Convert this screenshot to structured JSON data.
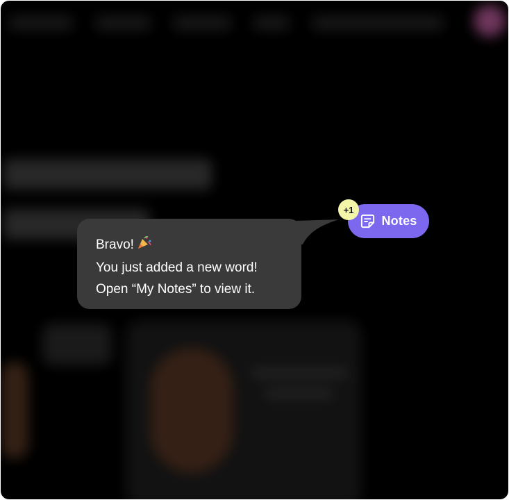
{
  "notes_button": {
    "label": "Notes",
    "icon": "sticky-note-icon",
    "color": "#7b68ee"
  },
  "badge": {
    "text": "+1",
    "color": "#f3f5a8"
  },
  "tooltip": {
    "line1": "Bravo!",
    "line1_icon": "party-popper-icon",
    "line2": "You just added a new word!",
    "line3": "Open “My Notes” to view it.",
    "background": "#3a3a3a"
  }
}
